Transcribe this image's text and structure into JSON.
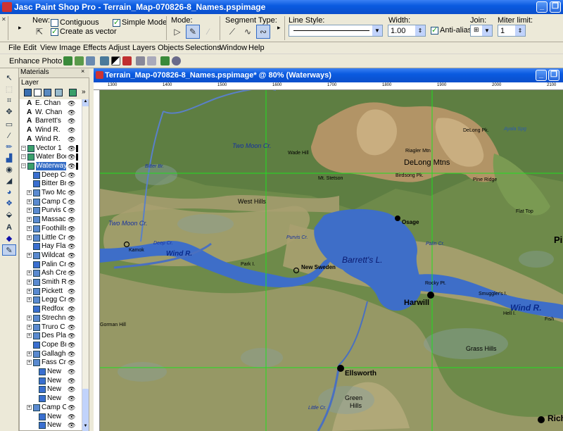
{
  "app": {
    "title": "Jasc Paint Shop Pro - Terrain_Map-070826-8_Names.pspimage"
  },
  "tool_options": {
    "new_label": "New:",
    "contiguous": "Contiguous",
    "create_vector": "Create as vector",
    "simple_mode": "Simple Mode",
    "mode_label": "Mode:",
    "segment_label": "Segment Type:",
    "line_style_label": "Line Style:",
    "width_label": "Width:",
    "width_value": "1.00",
    "antialias": "Anti-alias",
    "join_label": "Join:",
    "miter_label": "Miter limit:",
    "miter_value": "1"
  },
  "menu": [
    "File",
    "Edit",
    "View",
    "Image",
    "Effects",
    "Adjust",
    "Layers",
    "Objects",
    "Selections",
    "Window",
    "Help"
  ],
  "toolbar2": {
    "enhance": "Enhance Photo"
  },
  "palette": {
    "materials": "Materials",
    "layer": "Layer"
  },
  "layers": [
    {
      "name": "E. Chan",
      "ind": 2,
      "kind": "text"
    },
    {
      "name": "W. Chan",
      "ind": 2,
      "kind": "text"
    },
    {
      "name": "Barrett's",
      "ind": 2,
      "kind": "text"
    },
    {
      "name": "Wind R.",
      "ind": 2,
      "kind": "text"
    },
    {
      "name": "Wind R.",
      "ind": 2,
      "kind": "text"
    },
    {
      "name": "Vector 1",
      "ind": 1,
      "kind": "vector"
    },
    {
      "name": "Water Bod",
      "ind": 1,
      "kind": "vector"
    },
    {
      "name": "Waterways",
      "ind": 1,
      "kind": "vector",
      "sel": true
    },
    {
      "name": "Deep Cr",
      "ind": 2,
      "kind": "obj"
    },
    {
      "name": "Bitter Br",
      "ind": 2,
      "kind": "obj"
    },
    {
      "name": "Two Mc",
      "ind": 2,
      "kind": "grp"
    },
    {
      "name": "Camp Cr",
      "ind": 2,
      "kind": "grp"
    },
    {
      "name": "Purvis Cr",
      "ind": 2,
      "kind": "grp"
    },
    {
      "name": "Massacre",
      "ind": 2,
      "kind": "grp"
    },
    {
      "name": "Foothills",
      "ind": 2,
      "kind": "grp"
    },
    {
      "name": "Little Cr",
      "ind": 2,
      "kind": "grp"
    },
    {
      "name": "Hay Flat",
      "ind": 2,
      "kind": "obj"
    },
    {
      "name": "Wildcat",
      "ind": 2,
      "kind": "grp"
    },
    {
      "name": "Palin Cre",
      "ind": 2,
      "kind": "obj"
    },
    {
      "name": "Ash Cre",
      "ind": 2,
      "kind": "grp"
    },
    {
      "name": "Smith Ri",
      "ind": 2,
      "kind": "grp"
    },
    {
      "name": "Pickett",
      "ind": 2,
      "kind": "grp"
    },
    {
      "name": "Legg Cr",
      "ind": 2,
      "kind": "grp"
    },
    {
      "name": "Redfox",
      "ind": 2,
      "kind": "obj"
    },
    {
      "name": "Strechn",
      "ind": 2,
      "kind": "grp"
    },
    {
      "name": "Truro C",
      "ind": 2,
      "kind": "grp"
    },
    {
      "name": "Des Plair",
      "ind": 2,
      "kind": "grp"
    },
    {
      "name": "Cope Br",
      "ind": 2,
      "kind": "obj"
    },
    {
      "name": "Gallaghe",
      "ind": 2,
      "kind": "grp"
    },
    {
      "name": "Fass Cre",
      "ind": 2,
      "kind": "grp"
    },
    {
      "name": "New",
      "ind": 3,
      "kind": "obj"
    },
    {
      "name": "New",
      "ind": 3,
      "kind": "obj"
    },
    {
      "name": "New",
      "ind": 3,
      "kind": "obj"
    },
    {
      "name": "New",
      "ind": 3,
      "kind": "obj"
    },
    {
      "name": "Camp C",
      "ind": 2,
      "kind": "grp"
    },
    {
      "name": "New",
      "ind": 3,
      "kind": "obj"
    },
    {
      "name": "New",
      "ind": 3,
      "kind": "obj"
    }
  ],
  "document": {
    "title": "Terrain_Map-070826-8_Names.pspimage* @  80% (Waterways)",
    "ruler": [
      "1300",
      "1400",
      "1500",
      "1600",
      "1700",
      "1800",
      "1900",
      "2000",
      "2100"
    ]
  },
  "map_labels": {
    "two_moon_1": "Two Moon Cr.",
    "wade": "Wade Hill",
    "bitter": "Bitter Br.",
    "delong": "DeLong Mtns",
    "delong_pk": "DeLong Pk.",
    "riagler": "Riagler Mtn",
    "stetson": "Mt. Stetson",
    "birdsong": "Birdsong Pk.",
    "pine": "Pine Ridge",
    "west_hills": "West Hills",
    "osage": "Osage",
    "flat_top": "Flat Top",
    "two_moon_2": "Two Moon Cr.",
    "kamok": "Kamok",
    "deep": "Deep Cr.",
    "wind1": "Wind R.",
    "purvis": "Purvis Cr.",
    "palin": "Palin Cr.",
    "barretts": "Barrett's L.",
    "new_sweden": "New Sweden",
    "park": "Park I.",
    "rocky": "Rocky Pt.",
    "harwill": "Harwill",
    "smugglers": "Smuggler's I.",
    "hell": "Hell I.",
    "wind2": "Wind R.",
    "fish": "Fish",
    "grass": "Grass Hills",
    "gorman": "Gorman Hill",
    "ellsworth": "Ellsworth",
    "green": "Green",
    "hills": "Hills",
    "little": "Little Cr.",
    "rich": "Rich",
    "pi": "Pi",
    "ayala": "Ayala Spg"
  }
}
